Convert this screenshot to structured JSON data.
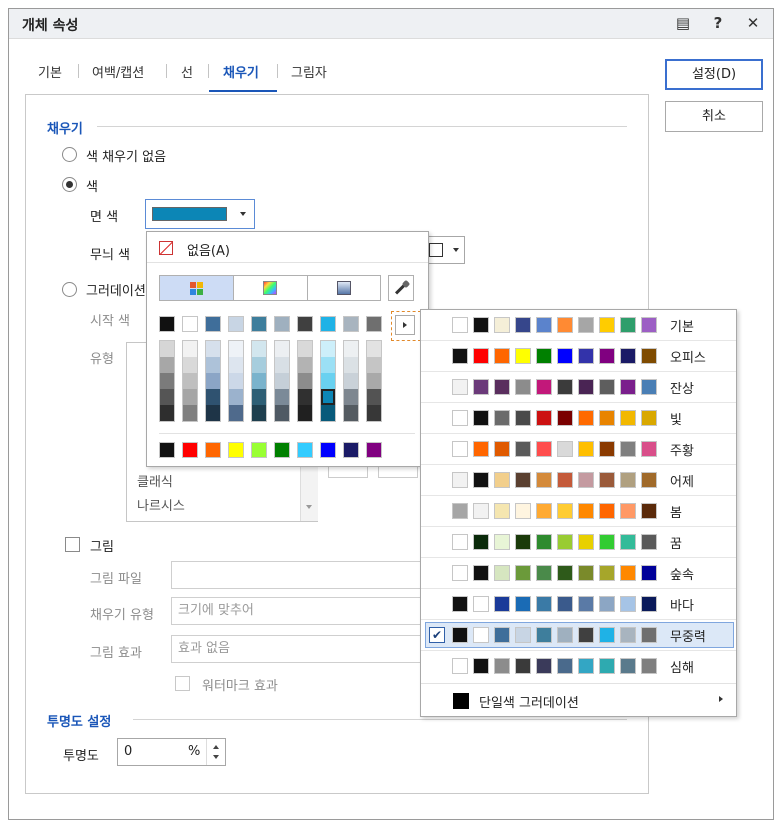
{
  "window": {
    "title": "개체 속성"
  },
  "titlebar_icons": [
    "memo-icon",
    "help-icon",
    "close-icon"
  ],
  "titlebar_glyphs": {
    "memo": "▤",
    "help": "?",
    "close": "✕"
  },
  "tabs": [
    {
      "label": "기본",
      "active": false
    },
    {
      "label": "여백/캡션",
      "active": false
    },
    {
      "label": "선",
      "active": false
    },
    {
      "label": "채우기",
      "active": true
    },
    {
      "label": "그림자",
      "active": false
    }
  ],
  "buttons": {
    "ok": "설정(D)",
    "cancel": "취소"
  },
  "fill": {
    "section_title": "채우기",
    "no_fill_label": "색 채우기 없음",
    "color_label": "색",
    "face_color_label": "면 색",
    "face_color": "#0c86b6",
    "pattern_color_label": "무늬 색",
    "gradient_label": "그러데이션",
    "start_color_label": "시작 색",
    "type_label": "유형",
    "gradient_types_visible": [
      "클래식",
      "나르시스"
    ]
  },
  "picture": {
    "label": "그림",
    "file_label": "그림 파일",
    "fill_type_label": "채우기 유형",
    "fill_type_value": "크기에 맞추어",
    "effect_label": "그림 효과",
    "effect_value": "효과 없음",
    "watermark_label": "워터마크 효과"
  },
  "transparency": {
    "section_title": "투명도 설정",
    "label": "투명도",
    "value": "0",
    "unit": "%"
  },
  "color_popup": {
    "none_label": "없음(A)",
    "top_row": [
      "#111111",
      "#ffffff",
      "#3f6e9a",
      "#c8d5e4",
      "#3e7e9c",
      "#9fb0bf",
      "#404040",
      "#1fb2e6",
      "#a8b4bf",
      "#6f6f6f"
    ],
    "shade_columns": [
      [
        "#d6d6d6",
        "#a7a7a7",
        "#7b7b7b",
        "#555555",
        "#2e2e2e"
      ],
      [
        "#f2f2f2",
        "#d9d9d9",
        "#bfbfbf",
        "#a6a6a6",
        "#7f7f7f"
      ],
      [
        "#d6e0ec",
        "#adc2d9",
        "#8ba5c6",
        "#2f5270",
        "#1e3447"
      ],
      [
        "#eef2f7",
        "#dde5ef",
        "#ccd8e8",
        "#9bb2cd",
        "#4f6a8c"
      ],
      [
        "#d2e6ee",
        "#a6cddd",
        "#7ab3cc",
        "#2e5f75",
        "#1e3f4e"
      ],
      [
        "#eceff2",
        "#d8dfe5",
        "#c5cfd8",
        "#7b8a98",
        "#4f5a64"
      ],
      [
        "#d9d9d9",
        "#b3b3b3",
        "#8c8c8c",
        "#303030",
        "#202020"
      ],
      [
        "#cdeffa",
        "#9be0f5",
        "#69d1f0",
        "#0c86b6",
        "#085a7a"
      ],
      [
        "#edf0f2",
        "#dbe1e5",
        "#c9d1d8",
        "#7e8790",
        "#545b61"
      ],
      [
        "#e2e2e2",
        "#c5c5c5",
        "#a9a9a9",
        "#535353",
        "#373737"
      ]
    ],
    "standard_row": [
      "#111111",
      "#ff0000",
      "#ff6600",
      "#ffff00",
      "#99ff33",
      "#008000",
      "#33ccff",
      "#0000ff",
      "#1a1a66",
      "#800080"
    ]
  },
  "theme_menu": {
    "selected": "무중력",
    "themes": [
      {
        "name": "기본",
        "colors": [
          "#ffffff",
          "#111111",
          "#f5efd8",
          "#36468b",
          "#5b83cc",
          "#ff8a33",
          "#a6a6a6",
          "#ffcc00",
          "#2e9e6b",
          "#9c5fc4"
        ]
      },
      {
        "name": "오피스",
        "colors": [
          "#111111",
          "#ff0000",
          "#ff6600",
          "#ffff00",
          "#008000",
          "#0000ff",
          "#3333aa",
          "#800080",
          "#1a1a66",
          "#7f4b00"
        ]
      },
      {
        "name": "잔상",
        "colors": [
          "#f2f2f2",
          "#6b3a7a",
          "#5a2e5e",
          "#8c8c8c",
          "#c2187a",
          "#3b3b3b",
          "#4a2454",
          "#5e5e5e",
          "#7a1f8c",
          "#4a7fb5"
        ]
      },
      {
        "name": "빛",
        "colors": [
          "#ffffff",
          "#111111",
          "#6b6b6b",
          "#4a4a4a",
          "#cc1111",
          "#7a0000",
          "#ff6a00",
          "#e88400",
          "#f2b800",
          "#d9a800"
        ]
      },
      {
        "name": "주황",
        "colors": [
          "#ffffff",
          "#ff6600",
          "#e05a00",
          "#5a5a5a",
          "#ff4d4d",
          "#d9d9d9",
          "#ffbf00",
          "#8a3a00",
          "#7f7f7f",
          "#d94f8a"
        ]
      },
      {
        "name": "어제",
        "colors": [
          "#f2f2f2",
          "#111111",
          "#f2cf8c",
          "#5a4030",
          "#d48a3a",
          "#c45a3a",
          "#c49aa0",
          "#9a5a3a",
          "#b0a080",
          "#a06a2a"
        ]
      },
      {
        "name": "봄",
        "colors": [
          "#a6a6a6",
          "#f2f2f2",
          "#f5e6b0",
          "#fff5e0",
          "#ffaa33",
          "#ffcc33",
          "#ff8800",
          "#ff6600",
          "#ff9966",
          "#5a2a0a"
        ]
      },
      {
        "name": "꿈",
        "colors": [
          "#ffffff",
          "#0a2a0a",
          "#e8f5d6",
          "#1a3a0a",
          "#2e8b2e",
          "#99cc33",
          "#e8d000",
          "#33cc33",
          "#33bb99",
          "#5a5a5a"
        ]
      },
      {
        "name": "숲속",
        "colors": [
          "#ffffff",
          "#111111",
          "#d6e6c0",
          "#6b9a3a",
          "#4a8a4a",
          "#2e5a1a",
          "#7a8a2a",
          "#a6a62a",
          "#ff8800",
          "#000099"
        ]
      },
      {
        "name": "바다",
        "colors": [
          "#111111",
          "#ffffff",
          "#1a3a99",
          "#1a6bb5",
          "#3a7aa6",
          "#3a5a8c",
          "#5a7aa6",
          "#8ca6c4",
          "#a6c4e6",
          "#0a1a5a"
        ]
      },
      {
        "name": "무중력",
        "colors": [
          "#111111",
          "#ffffff",
          "#3f6e9a",
          "#c8d5e4",
          "#3e7e9c",
          "#9fb0bf",
          "#404040",
          "#1fb2e6",
          "#a8b4bf",
          "#6f6f6f"
        ]
      },
      {
        "name": "심해",
        "colors": [
          "#ffffff",
          "#111111",
          "#8c8c8c",
          "#3a3a3a",
          "#3a3a5a",
          "#4a6a8c",
          "#33a6c4",
          "#2eaab0",
          "#5a7a8c",
          "#7f7f7f"
        ]
      }
    ],
    "gradient_item_label": "단일색 그러데이션"
  }
}
